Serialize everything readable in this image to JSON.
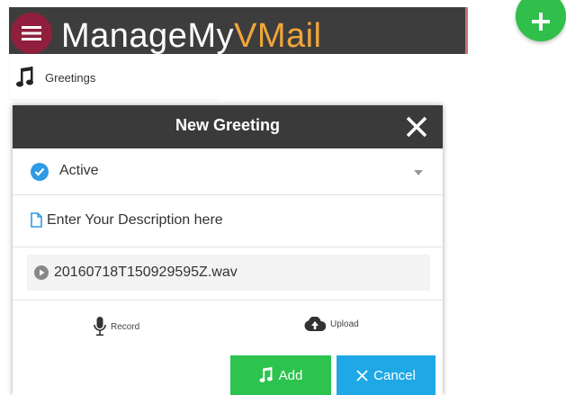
{
  "header": {
    "title_main": "ManageMy",
    "title_accent": "VMail"
  },
  "nav": {
    "label": "Greetings"
  },
  "modal": {
    "title": "New Greeting",
    "status": "Active",
    "description_placeholder": "Enter Your Description here",
    "file_name": "20160718T150929595Z.wav",
    "record_label": "Record",
    "upload_label": "Upload",
    "add_label": "Add",
    "cancel_label": "Cancel"
  },
  "colors": {
    "header_bg": "#3d3d3d",
    "accent": "#f0a63a",
    "menu_button": "#8f1f3c",
    "fab": "#2fbf4a",
    "add_button": "#2cc34e",
    "cancel_button": "#1ea8e6",
    "check": "#2f9ae5"
  },
  "icons": {
    "menu": "hamburger-icon",
    "fab": "plus-icon",
    "nav": "music-note-icon",
    "close": "close-icon",
    "status": "check-circle-icon",
    "description": "document-icon",
    "file": "play-circle-icon",
    "record": "microphone-icon",
    "upload": "cloud-upload-icon"
  }
}
